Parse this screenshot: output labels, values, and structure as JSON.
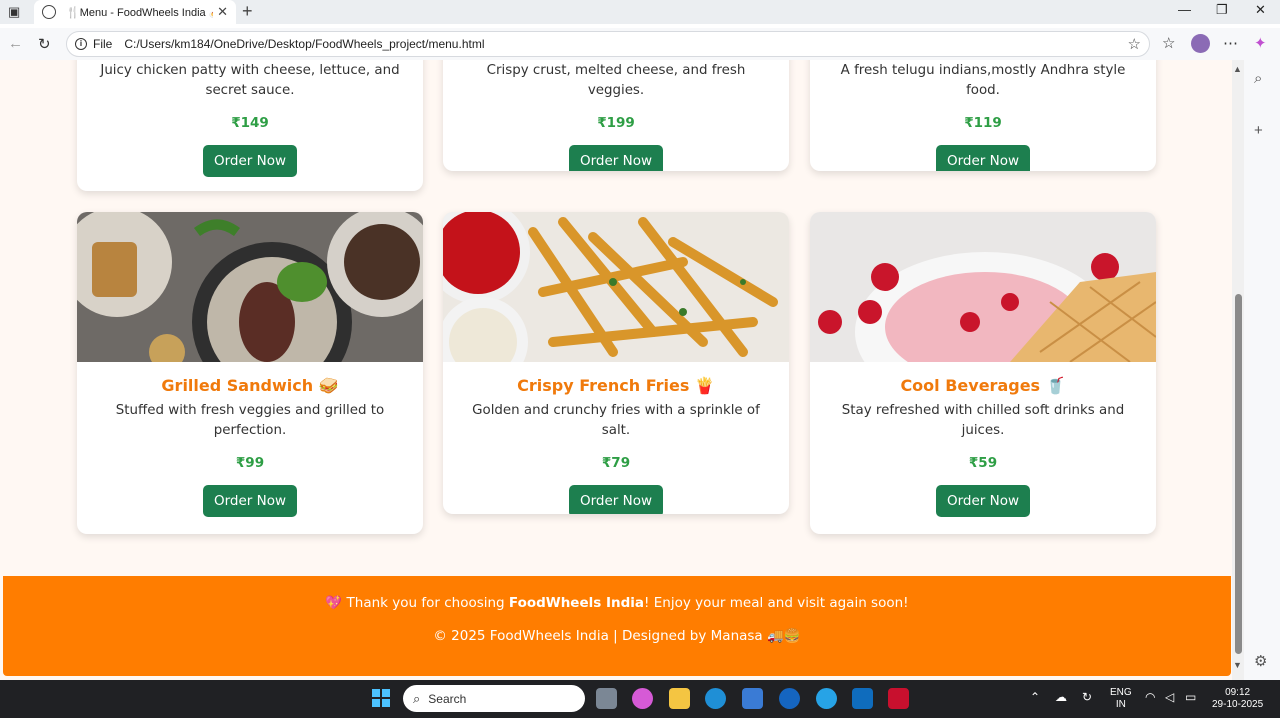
{
  "browser": {
    "tab_title": "🍴Menu - FoodWheels India 🍝🥤",
    "tab_close": "✕",
    "new_tab": "+",
    "scheme_label": "File",
    "url": "C:/Users/km184/OneDrive/Desktop/FoodWheels_project/menu.html"
  },
  "cards_top": [
    {
      "desc": "Juicy chicken patty with cheese, lettuce, and secret sauce.",
      "price": "₹149",
      "button": "Order Now"
    },
    {
      "desc": "Crispy crust, melted cheese, and fresh veggies.",
      "price": "₹199",
      "button": "Order Now"
    },
    {
      "desc": "A fresh telugu indians,mostly Andhra style food.",
      "price": "₹119",
      "button": "Order Now"
    }
  ],
  "cards_bottom": [
    {
      "title": "Grilled Sandwich 🥪",
      "desc": "Stuffed with fresh veggies and grilled to perfection.",
      "price": "₹99",
      "button": "Order Now"
    },
    {
      "title": "Crispy French Fries 🍟",
      "desc": "Golden and crunchy fries with a sprinkle of salt.",
      "price": "₹79",
      "button": "Order Now"
    },
    {
      "title": "Cool Beverages 🥤",
      "desc": "Stay refreshed with chilled soft drinks and juices.",
      "price": "₹59",
      "button": "Order Now"
    }
  ],
  "footer": {
    "thanks_prefix": "💖 Thank you for choosing ",
    "brand": "FoodWheels India",
    "thanks_suffix": "! Enjoy your meal and visit again soon!",
    "copyright": "© 2025 FoodWheels India | Designed by Manasa 🚚🍔"
  },
  "taskbar": {
    "search_placeholder": "Search",
    "lang_top": "ENG",
    "lang_bottom": "IN",
    "time": "09:12",
    "date": "29-10-2025"
  },
  "colors": {
    "accent_orange": "#ff7d00",
    "title_orange": "#f07a0c",
    "price_green": "#2e9e45",
    "button_green": "#1d7f4f",
    "page_bg": "#fff8f3"
  }
}
